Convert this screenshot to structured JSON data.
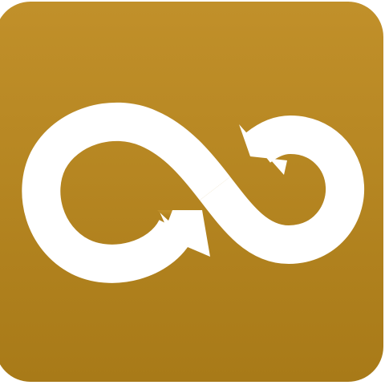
{
  "icon": {
    "name": "infinity-loop-arrows-icon",
    "colors": {
      "background_top": "#c1902a",
      "background_bottom": "#a87a18",
      "glyph": "#ffffff",
      "border": "#ffffff"
    }
  }
}
